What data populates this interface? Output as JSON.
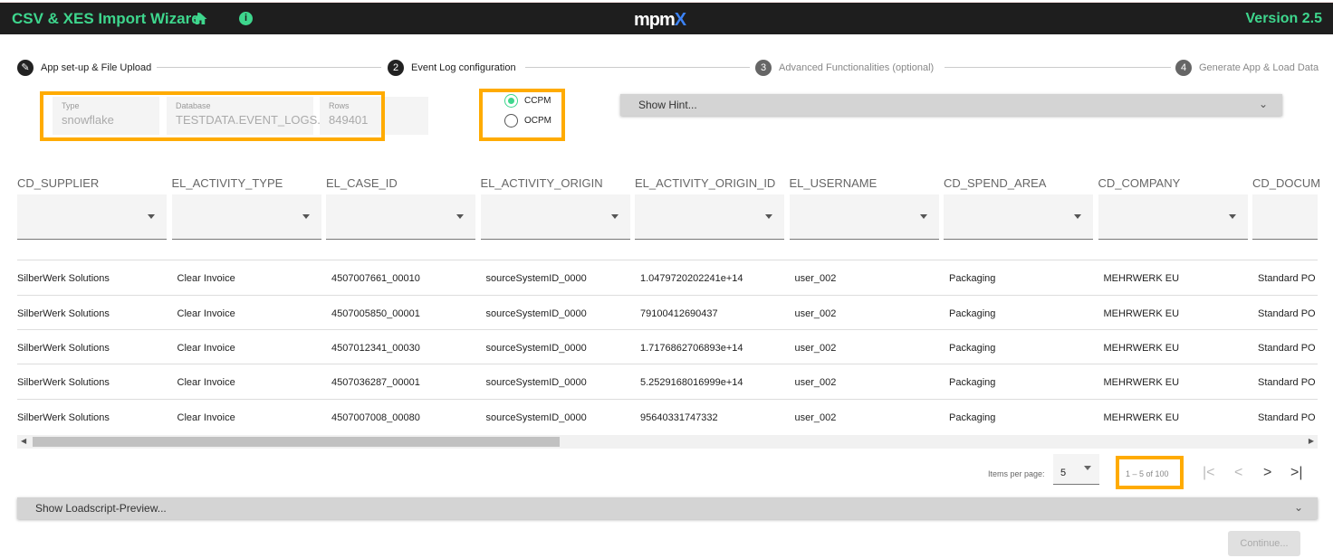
{
  "header": {
    "title": "CSV & XES Import Wizard",
    "logo": "mpmX",
    "version": "Version 2.5",
    "accent": "#3ed68d"
  },
  "steps": [
    {
      "num": "✎",
      "label": "App set-up & File Upload"
    },
    {
      "num": "2",
      "label": "Event Log configuration"
    },
    {
      "num": "3",
      "label": "Advanced Functionalities (optional)"
    },
    {
      "num": "4",
      "label": "Generate App & Load Data"
    }
  ],
  "source": {
    "type_label": "Type",
    "type": "snowflake",
    "db_label": "Database",
    "db": "TESTDATA.EVENT_LOGS.",
    "rows_label": "Rows",
    "rows": "849401"
  },
  "mode": {
    "options": [
      "CCPM",
      "OCPM"
    ],
    "selected": "CCPM"
  },
  "hint": "Show Hint...",
  "columns": [
    "CD_SUPPLIER",
    "EL_ACTIVITY_TYPE",
    "EL_CASE_ID",
    "EL_ACTIVITY_ORIGIN",
    "EL_ACTIVITY_ORIGIN_ID",
    "EL_USERNAME",
    "CD_SPEND_AREA",
    "CD_COMPANY",
    "CD_DOCUM"
  ],
  "rows": [
    [
      "SilberWerk Solutions",
      "Clear Invoice",
      "4507007661_00010",
      "sourceSystemID_0000",
      "1.0479720202241e+14",
      "user_002",
      "Packaging",
      "MEHRWERK EU",
      "Standard PO"
    ],
    [
      "SilberWerk Solutions",
      "Clear Invoice",
      "4507005850_00001",
      "sourceSystemID_0000",
      "79100412690437",
      "user_002",
      "Packaging",
      "MEHRWERK EU",
      "Standard PO"
    ],
    [
      "SilberWerk Solutions",
      "Clear Invoice",
      "4507012341_00030",
      "sourceSystemID_0000",
      "1.7176862706893e+14",
      "user_002",
      "Packaging",
      "MEHRWERK EU",
      "Standard PO"
    ],
    [
      "SilberWerk Solutions",
      "Clear Invoice",
      "4507036287_00001",
      "sourceSystemID_0000",
      "5.2529168016999e+14",
      "user_002",
      "Packaging",
      "MEHRWERK EU",
      "Standard PO"
    ],
    [
      "SilberWerk Solutions",
      "Clear Invoice",
      "4507007008_00080",
      "sourceSystemID_0000",
      "95640331747332",
      "user_002",
      "Packaging",
      "MEHRWERK EU",
      "Standard PO"
    ]
  ],
  "pagination": {
    "items_label": "Items per page:",
    "items": "5",
    "range": "1 – 5 of 100"
  },
  "loadscript": "Show Loadscript-Preview...",
  "continue": "Continue..."
}
